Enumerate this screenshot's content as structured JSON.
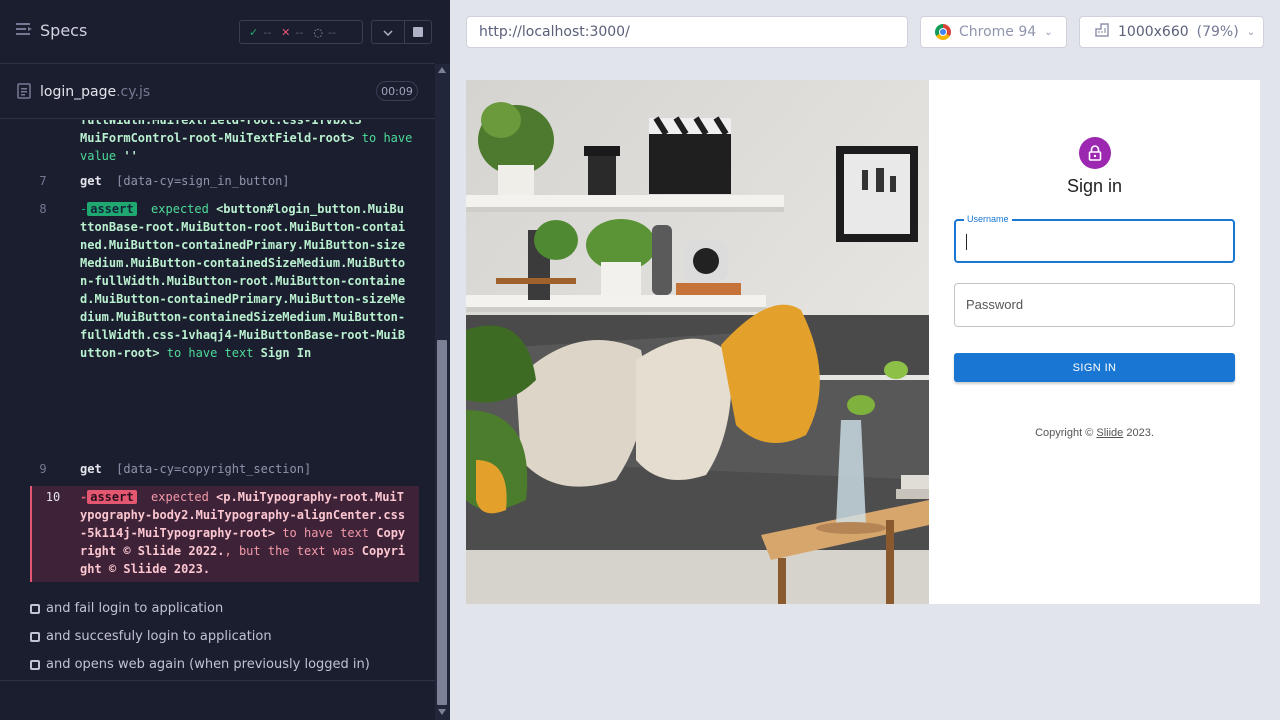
{
  "reporter": {
    "title": "Specs",
    "stats": {
      "passed": "--",
      "failed": "--",
      "pending": "--"
    },
    "file": {
      "name": "login_page",
      "ext": ".cy.js",
      "duration": "00:09"
    },
    "commands": [
      {
        "num": "",
        "partial_lines": [
          "fullWidth.MuiTextField-root.css-1fvbxl3",
          "MuiFormControl-root-MuiTextField-root>"
        ],
        "to_have": "to have",
        "value_word": "value",
        "value": "''"
      },
      {
        "num": "7",
        "name": "get",
        "selector": "[data-cy=sign_in_button]"
      },
      {
        "num": "8",
        "badge": "assert",
        "expected": "expected",
        "element": "<button#login_button.MuiButtonBase-root.MuiButton-root.MuiButton-contained.MuiButton-containedPrimary.MuiButton-sizeMedium.MuiButton-containedSizeMedium.MuiButton-fullWidth.MuiButton-root.MuiButton-contained.MuiButton-containedPrimary.MuiButton-sizeMedium.MuiButton-containedSizeMedium.MuiButton-fullWidth.css-1vhaqj4-MuiButtonBase-root-MuiButton-root>",
        "to_have": "to have text",
        "value": "Sign In"
      },
      {
        "num": "9",
        "name": "get",
        "selector": "[data-cy=copyright_section]"
      },
      {
        "num": "10",
        "badge": "assert",
        "expected": "expected",
        "element": "<p.MuiTypography-root.MuiTypography-body2.MuiTypography-alignCenter.css-5k114j-MuiTypography-root>",
        "to_have": "to have text",
        "expected_value": "Copyright © Sliide 2022.",
        "but": ", but the text was",
        "actual_value": "Copyright © Sliide 2023."
      }
    ],
    "pending_tests": [
      "and fail login to application",
      "and succesfuly login to application",
      "and opens web again (when previously logged in)"
    ]
  },
  "browser": {
    "url": "http://localhost:3000/",
    "browser_name": "Chrome 94",
    "viewport": "1000x660",
    "scale": "(79%)"
  },
  "app": {
    "sign_in_title": "Sign in",
    "username_label": "Username",
    "password_placeholder": "Password",
    "sign_in_button": "SIGN IN",
    "copyright_prefix": "Copyright © ",
    "copyright_link": "Sliide",
    "copyright_suffix": " 2023.",
    "photo_desc": "living room with grey sofa, cushions, plants and shelves"
  },
  "colors": {
    "reporter_bg": "#1b1e2e",
    "pass": "#1fa971",
    "fail": "#e45770",
    "primary": "#1976d2",
    "avatar": "#9c27b0"
  }
}
